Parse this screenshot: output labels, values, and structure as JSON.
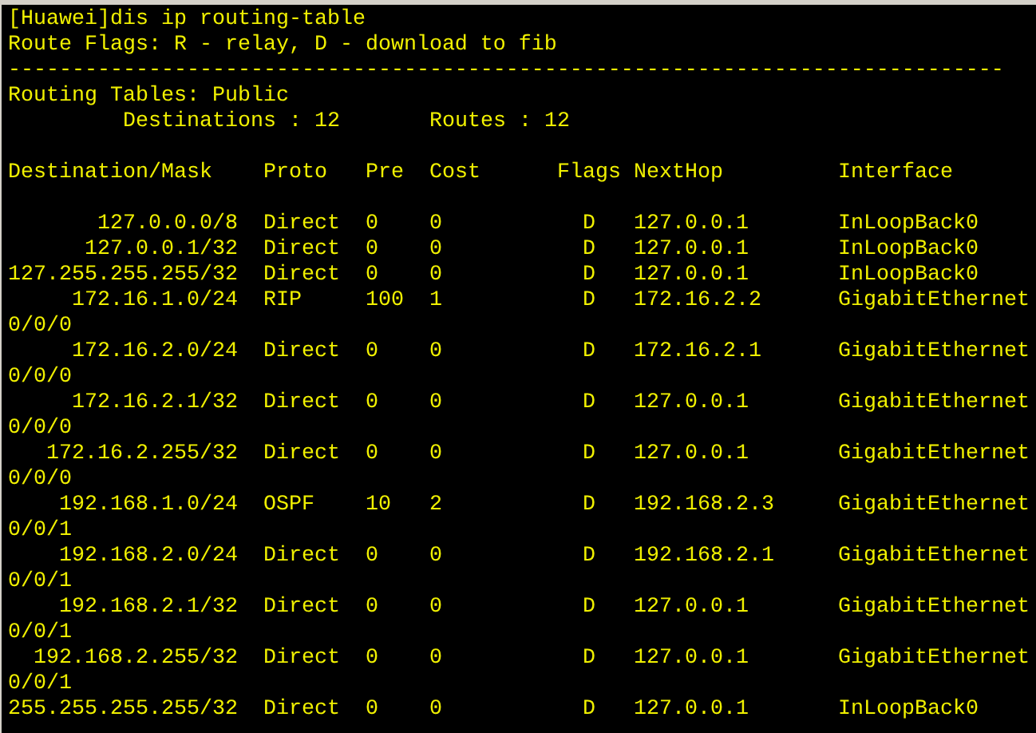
{
  "terminal": {
    "command": "[Huawei]dis ip routing-table",
    "flags_legend": "Route Flags: R - relay, D - download to fib",
    "separator": "------------------------------------------------------------------------------",
    "table_name": "Routing Tables: Public",
    "destinations": "Destinations : 12",
    "routes": "Routes : 12",
    "columns": [
      "Destination/Mask",
      "Proto",
      "Pre",
      "Cost",
      "Flags",
      "NextHop",
      "Interface"
    ],
    "rows": [
      {
        "destination": "127.0.0.0/8",
        "proto": "Direct",
        "pre": "0",
        "cost": "0",
        "flags": "D",
        "nexthop": "127.0.0.1",
        "interface": "InLoopBack0"
      },
      {
        "destination": "127.0.0.1/32",
        "proto": "Direct",
        "pre": "0",
        "cost": "0",
        "flags": "D",
        "nexthop": "127.0.0.1",
        "interface": "InLoopBack0"
      },
      {
        "destination": "127.255.255.255/32",
        "proto": "Direct",
        "pre": "0",
        "cost": "0",
        "flags": "D",
        "nexthop": "127.0.0.1",
        "interface": "InLoopBack0"
      },
      {
        "destination": "172.16.1.0/24",
        "proto": "RIP",
        "pre": "100",
        "cost": "1",
        "flags": "D",
        "nexthop": "172.16.2.2",
        "interface": "GigabitEthernet",
        "interface_wrap": "0/0/0"
      },
      {
        "destination": "172.16.2.0/24",
        "proto": "Direct",
        "pre": "0",
        "cost": "0",
        "flags": "D",
        "nexthop": "172.16.2.1",
        "interface": "GigabitEthernet",
        "interface_wrap": "0/0/0"
      },
      {
        "destination": "172.16.2.1/32",
        "proto": "Direct",
        "pre": "0",
        "cost": "0",
        "flags": "D",
        "nexthop": "127.0.0.1",
        "interface": "GigabitEthernet",
        "interface_wrap": "0/0/0"
      },
      {
        "destination": "172.16.2.255/32",
        "proto": "Direct",
        "pre": "0",
        "cost": "0",
        "flags": "D",
        "nexthop": "127.0.0.1",
        "interface": "GigabitEthernet",
        "interface_wrap": "0/0/0"
      },
      {
        "destination": "192.168.1.0/24",
        "proto": "OSPF",
        "pre": "10",
        "cost": "2",
        "flags": "D",
        "nexthop": "192.168.2.3",
        "interface": "GigabitEthernet",
        "interface_wrap": "0/0/1"
      },
      {
        "destination": "192.168.2.0/24",
        "proto": "Direct",
        "pre": "0",
        "cost": "0",
        "flags": "D",
        "nexthop": "192.168.2.1",
        "interface": "GigabitEthernet",
        "interface_wrap": "0/0/1"
      },
      {
        "destination": "192.168.2.1/32",
        "proto": "Direct",
        "pre": "0",
        "cost": "0",
        "flags": "D",
        "nexthop": "127.0.0.1",
        "interface": "GigabitEthernet",
        "interface_wrap": "0/0/1"
      },
      {
        "destination": "192.168.2.255/32",
        "proto": "Direct",
        "pre": "0",
        "cost": "0",
        "flags": "D",
        "nexthop": "127.0.0.1",
        "interface": "GigabitEthernet",
        "interface_wrap": "0/0/1"
      },
      {
        "destination": "255.255.255.255/32",
        "proto": "Direct",
        "pre": "0",
        "cost": "0",
        "flags": "D",
        "nexthop": "127.0.0.1",
        "interface": "InLoopBack0"
      }
    ]
  }
}
